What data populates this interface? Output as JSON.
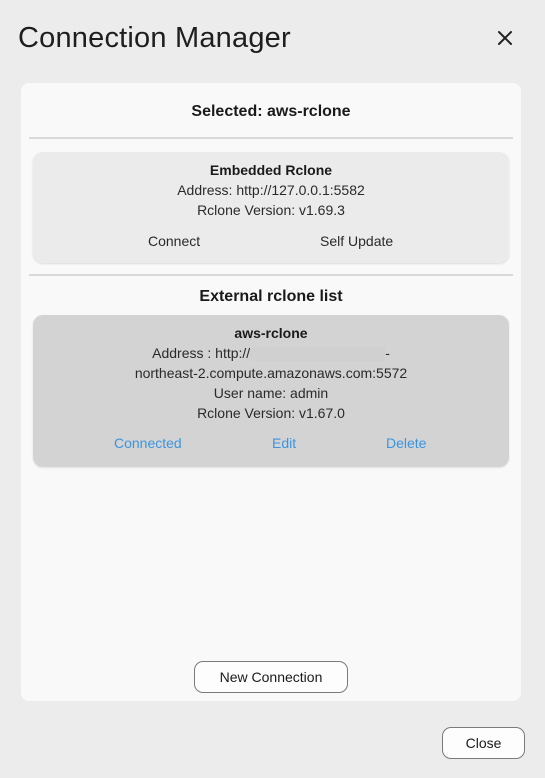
{
  "window": {
    "title": "Connection Manager",
    "close_icon": "close-icon"
  },
  "selected": {
    "label": "Selected: aws-rclone"
  },
  "embedded": {
    "name": "Embedded Rclone",
    "address": "Address: http://127.0.0.1:5582",
    "version": "Rclone Version: v1.69.3",
    "connect_label": "Connect",
    "self_update_label": "Self Update"
  },
  "external": {
    "section_title": "External rclone list",
    "items": [
      {
        "name": "aws-rclone",
        "address_prefix": "Address : http://",
        "address_suffix": "-",
        "address_line2": "northeast-2.compute.amazonaws.com:5572",
        "username": "User name: admin",
        "version": "Rclone Version: v1.67.0",
        "status_label": "Connected",
        "edit_label": "Edit",
        "delete_label": "Delete"
      }
    ]
  },
  "footer": {
    "new_connection_label": "New Connection",
    "close_label": "Close"
  },
  "colors": {
    "background": "#ececec",
    "panel": "#f9f9f9",
    "link_blue": "#3a95e0",
    "selected_card": "#d3d3d3"
  }
}
